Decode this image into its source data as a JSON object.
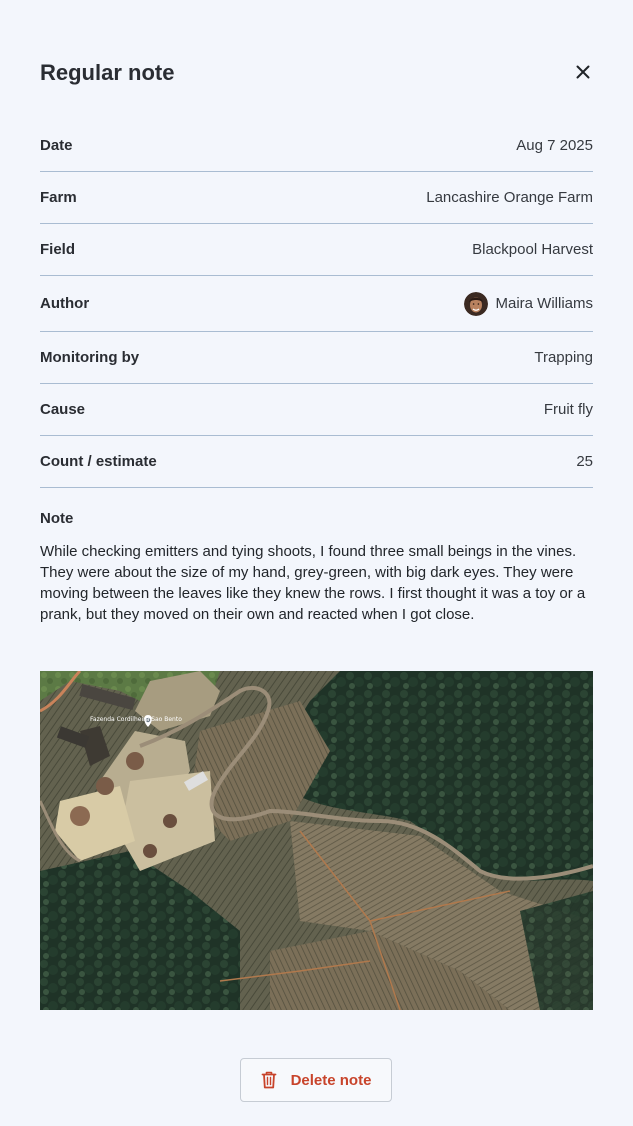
{
  "header": {
    "title": "Regular note",
    "close_icon": "close-icon"
  },
  "details": [
    {
      "label": "Date",
      "value": "Aug 7 2025"
    },
    {
      "label": "Farm",
      "value": "Lancashire Orange Farm"
    },
    {
      "label": "Field",
      "value": "Blackpool Harvest"
    },
    {
      "label": "Author",
      "value": "Maira Williams",
      "icon": "avatar"
    },
    {
      "label": "Monitoring by",
      "value": "Trapping"
    },
    {
      "label": "Cause",
      "value": "Fruit fly"
    },
    {
      "label": "Count / estimate",
      "value": "25"
    }
  ],
  "note": {
    "label": "Note",
    "text": "While checking emitters and tying shoots, I found three small beings in the vines. They were about the size of my hand, grey-green, with big dark eyes. They were moving between the leaves like they knew the rows. I first thought it was a toy or a prank, but they moved on their own and reacted when I got close.",
    "image": {
      "kind": "satellite map",
      "pin_label": "Fazenda Cordilheira Sao Bento"
    }
  },
  "actions": {
    "delete_label": "Delete note",
    "delete_icon": "trash-icon"
  },
  "colors": {
    "background": "#f3f6fc",
    "divider": "#a9bcd2",
    "danger": "#c8442b"
  }
}
